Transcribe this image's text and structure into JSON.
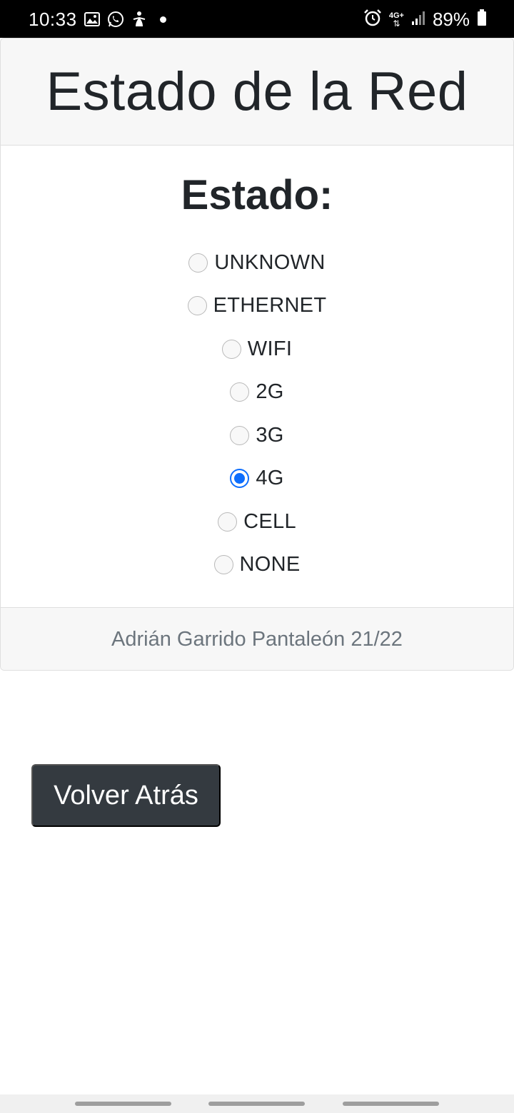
{
  "status_bar": {
    "time": "10:33",
    "notifications": [
      "image-icon",
      "whatsapp-icon",
      "accessibility-icon",
      "dot"
    ],
    "network_label": "4G+",
    "battery_percent": "89%",
    "icons": [
      "alarm-icon",
      "4g-signal-icon",
      "signal-bars-icon",
      "battery-icon"
    ]
  },
  "header": {
    "title": "Estado de la Red"
  },
  "body": {
    "heading": "Estado:",
    "options": [
      {
        "label": "UNKNOWN",
        "checked": false
      },
      {
        "label": "ETHERNET",
        "checked": false
      },
      {
        "label": "WIFI",
        "checked": false
      },
      {
        "label": "2G",
        "checked": false
      },
      {
        "label": "3G",
        "checked": false
      },
      {
        "label": "4G",
        "checked": true
      },
      {
        "label": "CELL",
        "checked": false
      },
      {
        "label": "NONE",
        "checked": false
      }
    ]
  },
  "footer": {
    "text": "Adrián Garrido Pantaleón 21/22"
  },
  "back_button": {
    "label": "Volver Atrás"
  },
  "colors": {
    "accent": "#0d6efd",
    "button_bg": "#343a40",
    "header_bg": "#f7f7f7"
  }
}
